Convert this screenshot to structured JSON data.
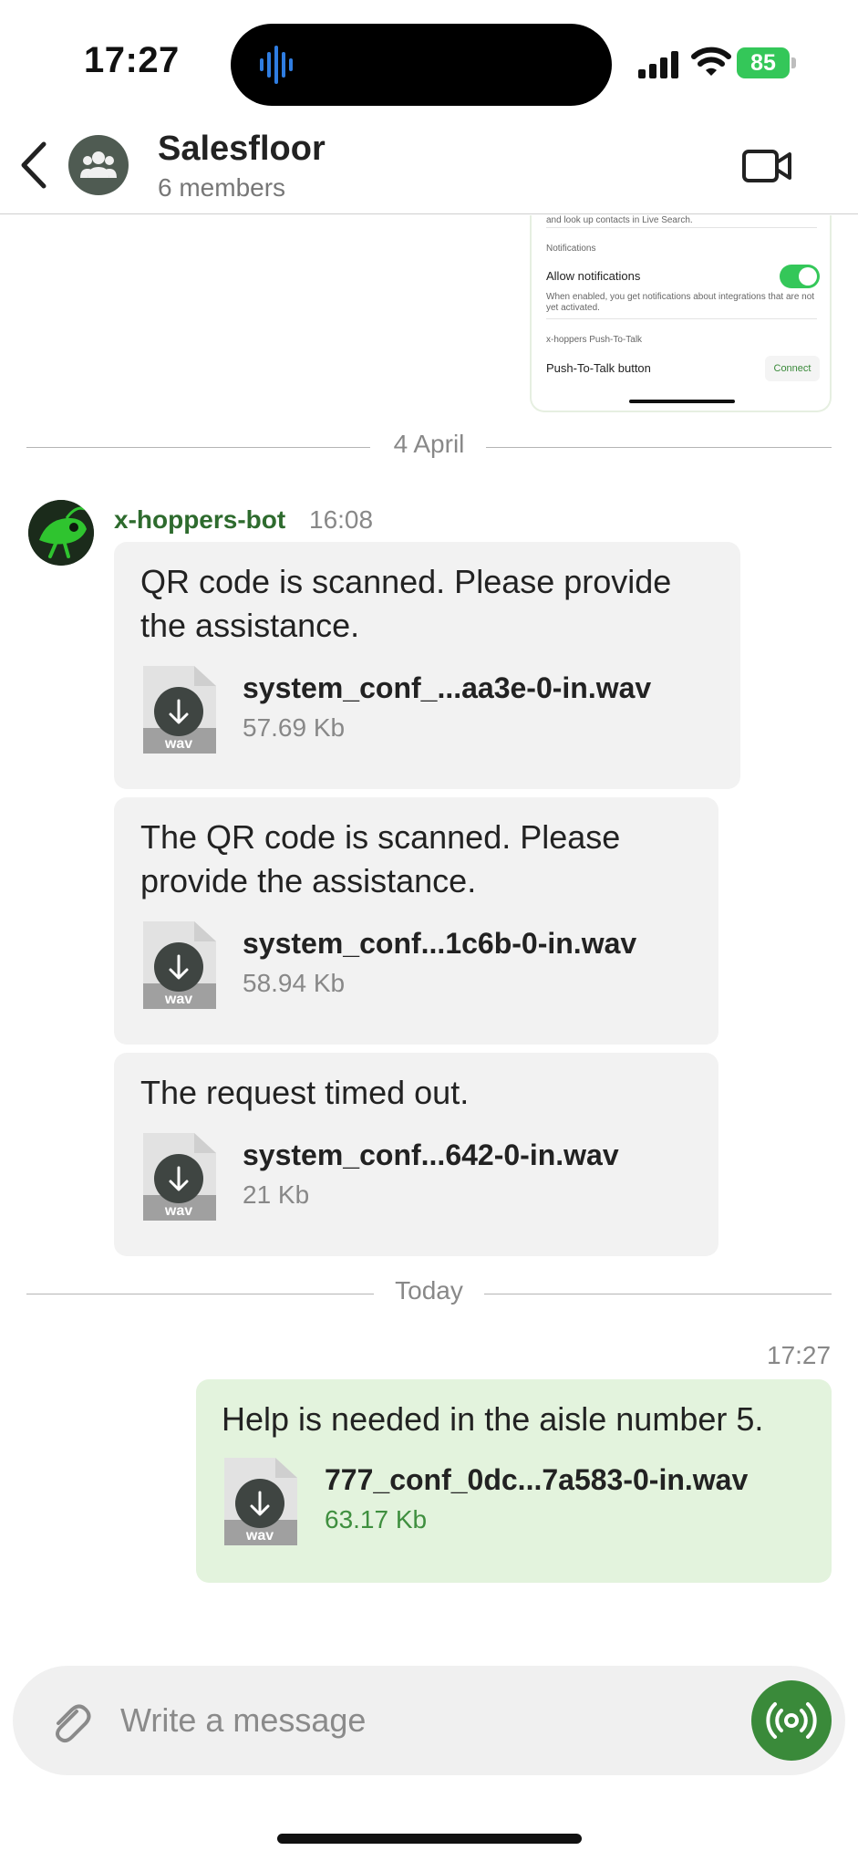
{
  "status_bar": {
    "time": "17:27",
    "battery": "85"
  },
  "header": {
    "title": "Salesfloor",
    "subtitle": "6 members"
  },
  "shared_screenshot": {
    "line_top": "and look up contacts in Live Search.",
    "section_notifications": "Notifications",
    "allow_notifications": "Allow notifications",
    "notifications_help": "When enabled, you get notifications about integrations that are not yet activated.",
    "section_ptt": "x-hoppers Push-To-Talk",
    "ptt_button_label": "Push-To-Talk button",
    "connect_label": "Connect"
  },
  "dividers": {
    "april": "4 April",
    "today": "Today"
  },
  "bot_message": {
    "sender": "x-hoppers-bot",
    "time": "16:08"
  },
  "messages": [
    {
      "text": "QR code is scanned. Please provide the assistance.",
      "file_name": "system_conf_...aa3e-0-in.wav",
      "file_size": "57.69 Kb",
      "file_ext": "wav"
    },
    {
      "text": "The QR code is scanned. Please provide the assistance.",
      "file_name": "system_conf...1c6b-0-in.wav",
      "file_size": "58.94 Kb",
      "file_ext": "wav"
    },
    {
      "text": "The request timed out.",
      "file_name": "system_conf...642-0-in.wav",
      "file_size": "21 Kb",
      "file_ext": "wav"
    }
  ],
  "outgoing_message": {
    "time": "17:27",
    "text": "Help is needed in the aisle number 5.",
    "file_name": "777_conf_0dc...7a583-0-in.wav",
    "file_size": "63.17 Kb",
    "file_ext": "wav"
  },
  "composer": {
    "placeholder": "Write a message"
  },
  "icons": {
    "back": "chevron-left-icon",
    "group": "group-icon",
    "video": "video-call-icon",
    "attach": "paperclip-icon",
    "ptt": "broadcast-icon",
    "download": "download-icon"
  },
  "colors": {
    "accent_green": "#3a8a3a",
    "outgoing_bubble": "#e3f3dd",
    "incoming_bubble": "#f2f2f2",
    "bot_name": "#2e6b2e"
  }
}
